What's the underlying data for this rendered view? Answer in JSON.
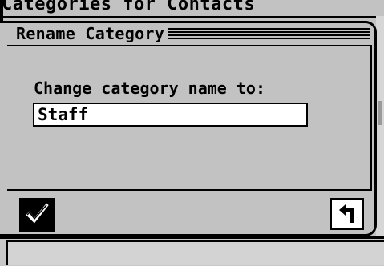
{
  "background_window": {
    "title": "Categories for Contacts"
  },
  "dialog": {
    "title": "Rename Category",
    "prompt_label": "Change category name to:",
    "name_input_value": "Staff"
  },
  "icons": {
    "ok": "checkmark-icon",
    "back": "return-arrow-icon"
  },
  "colors": {
    "background": "#c2c2c2",
    "ink": "#000000",
    "field": "#ffffff"
  }
}
